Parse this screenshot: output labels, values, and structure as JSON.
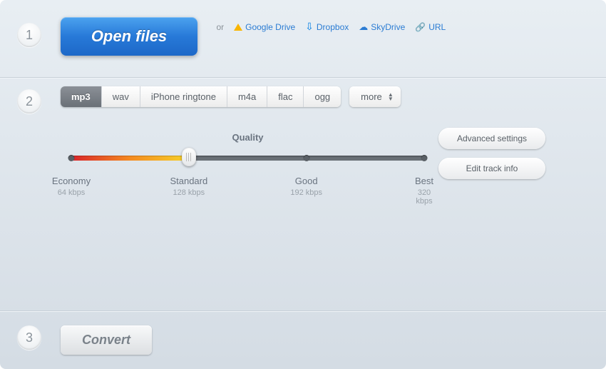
{
  "steps": {
    "one": "1",
    "two": "2",
    "three": "3"
  },
  "open": {
    "label": "Open files"
  },
  "sources": {
    "or": "or",
    "drive": "Google Drive",
    "dropbox": "Dropbox",
    "skydrive": "SkyDrive",
    "url": "URL"
  },
  "formats": {
    "tabs": [
      "mp3",
      "wav",
      "iPhone ringtone",
      "m4a",
      "flac",
      "ogg"
    ],
    "active_index": 0,
    "more": "more"
  },
  "quality": {
    "title": "Quality",
    "levels": [
      {
        "name": "Economy",
        "rate": "64 kbps",
        "pos": 0
      },
      {
        "name": "Standard",
        "rate": "128 kbps",
        "pos": 33.3
      },
      {
        "name": "Good",
        "rate": "192 kbps",
        "pos": 66.6
      },
      {
        "name": "Best",
        "rate": "320 kbps",
        "pos": 100
      }
    ],
    "selected_index": 1
  },
  "side": {
    "advanced": "Advanced settings",
    "edit": "Edit track info"
  },
  "convert": {
    "label": "Convert"
  }
}
